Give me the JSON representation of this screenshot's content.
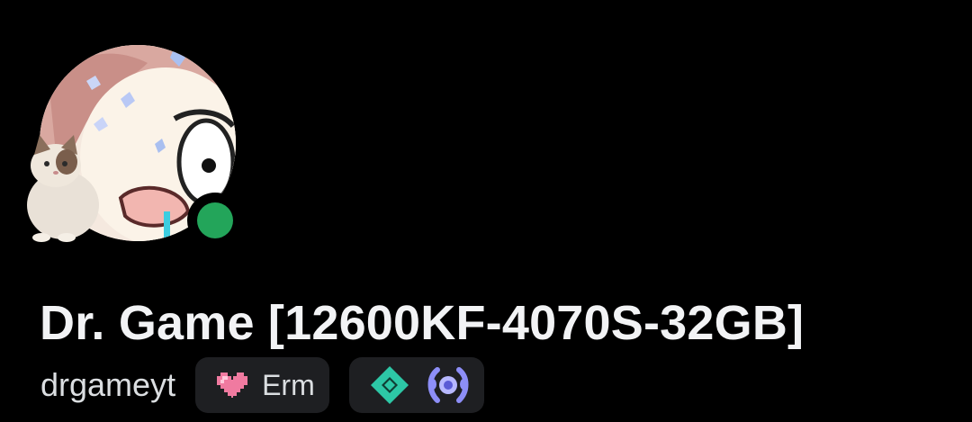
{
  "profile": {
    "display_name": "Dr. Game [12600KF-4070S-32GB]",
    "username": "drgameyt",
    "status": "online",
    "status_color": "#23a55a",
    "avatar_icon": "anime-avatar-icon",
    "avatar_decoration_icon": "cat-decoration-icon"
  },
  "custom_status": {
    "emoji_icon": "pixel-heart-icon",
    "text": "Erm"
  },
  "badges": [
    {
      "icon": "quest-diamond-badge-icon",
      "color": "#2dc7a6"
    },
    {
      "icon": "nitro-laurel-badge-icon",
      "color": "#8d8ef7"
    }
  ],
  "colors": {
    "background": "#000000",
    "pill_background": "#1e1f22",
    "text_primary": "#f2f3f5",
    "text_secondary": "#dbdee1"
  }
}
